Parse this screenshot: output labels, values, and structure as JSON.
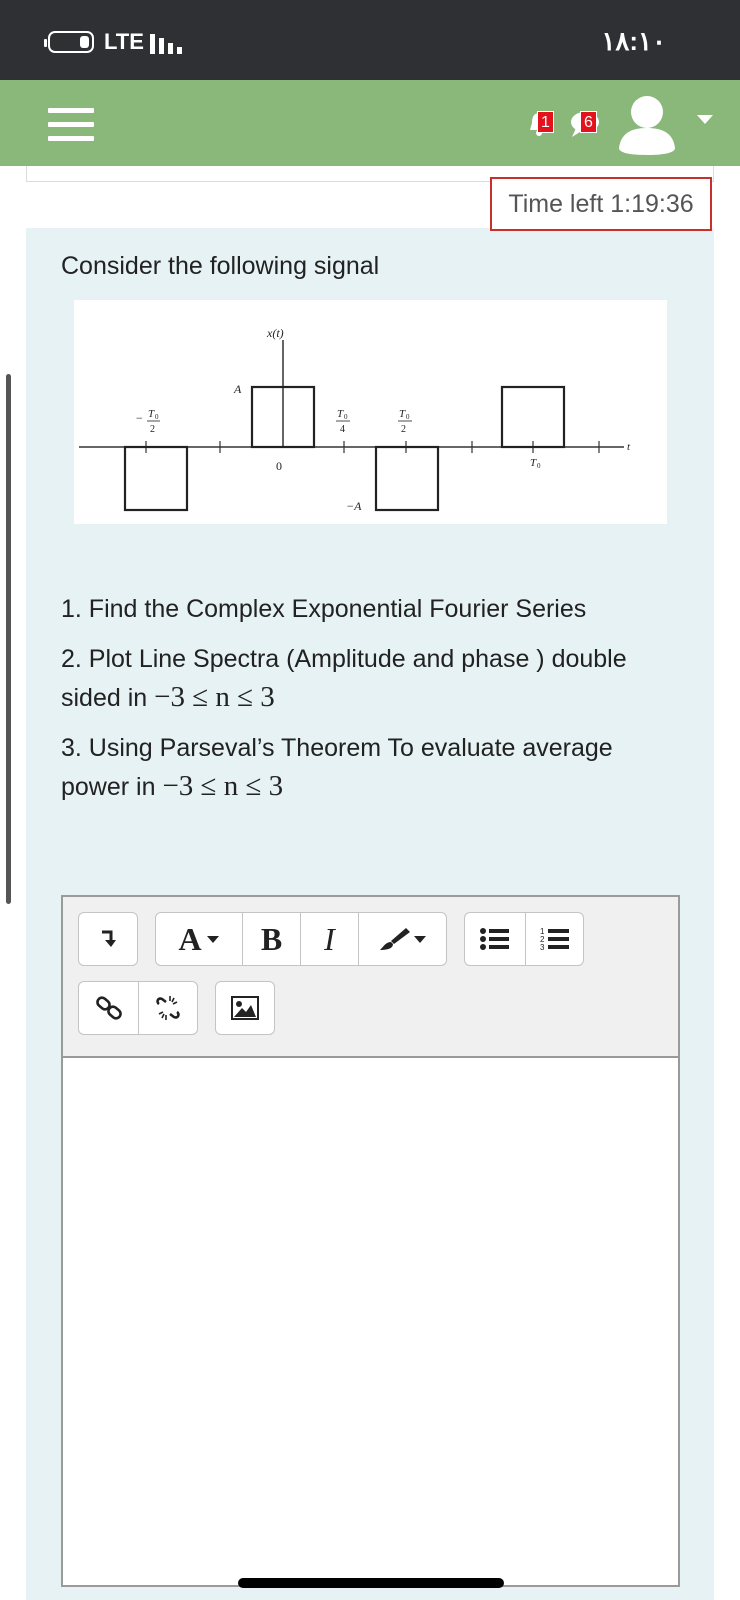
{
  "status_bar": {
    "network": "LTE",
    "time": "١٨:١٠"
  },
  "header": {
    "notifications_count": "1",
    "messages_count": "6"
  },
  "quiz": {
    "timer": "Time left 1:19:36",
    "prompt": "Consider the following signal",
    "figure_labels": {
      "y_axis": "x(t)",
      "amplitude_pos": "A",
      "amplitude_neg": "−A",
      "origin": "0",
      "t_axis": "t",
      "neg_half": "−",
      "t0": "T",
      "sub0": "0",
      "den2": "2",
      "den4": "4"
    },
    "questions": {
      "q1": "1. Find the Complex Exponential Fourier Series",
      "q2_text": "2. Plot Line Spectra (Amplitude and phase ) double sided in ",
      "q2_math": "−3 ≤ n ≤ 3",
      "q3_text": "3. Using Parseval’s Theorem To evaluate average power in ",
      "q3_math": "−3 ≤ n ≤ 3"
    }
  },
  "editor": {
    "toolbar_text": {
      "font_button": "A",
      "bold_button": "B",
      "italic_button": "I"
    },
    "icons": [
      "expand-toolbar-icon",
      "font-icon",
      "bold-icon",
      "italic-icon",
      "paint-brush-icon",
      "unordered-list-icon",
      "ordered-list-icon",
      "link-icon",
      "unlink-icon",
      "image-icon"
    ]
  }
}
